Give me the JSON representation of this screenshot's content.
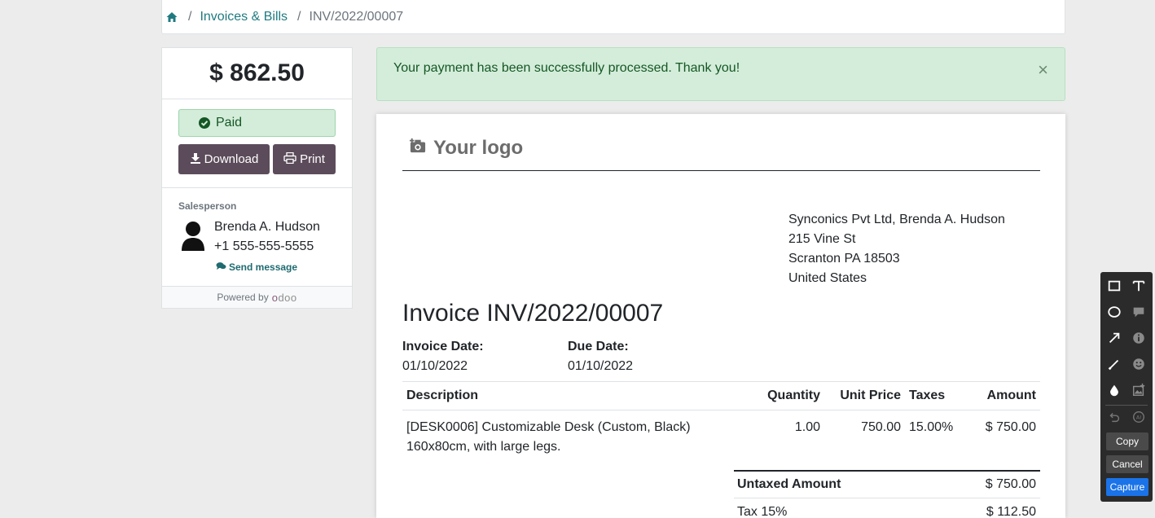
{
  "breadcrumb": {
    "home_icon": "home-icon",
    "link": "Invoices & Bills",
    "current": "INV/2022/00007"
  },
  "summary": {
    "amount": "$ 862.50",
    "status": "Paid",
    "download_label": "Download",
    "print_label": "Print",
    "salesperson_label": "Salesperson",
    "salesperson_name": "Brenda A. Hudson",
    "salesperson_phone": "+1 555-555-5555",
    "send_message_label": "Send message",
    "powered_by": "Powered by",
    "brand": "odoo"
  },
  "alert": {
    "message": "Your payment has been successfully processed. Thank you!",
    "close": "×"
  },
  "invoice": {
    "logo_text": "Your logo",
    "address": [
      "Synconics Pvt Ltd, Brenda A. Hudson",
      "215 Vine St",
      "Scranton PA 18503",
      "United States"
    ],
    "title": "Invoice INV/2022/00007",
    "invoice_date_label": "Invoice Date:",
    "invoice_date": "01/10/2022",
    "due_date_label": "Due Date:",
    "due_date": "01/10/2022",
    "columns": {
      "description": "Description",
      "quantity": "Quantity",
      "unit_price": "Unit Price",
      "taxes": "Taxes",
      "amount": "Amount"
    },
    "lines": [
      {
        "description_1": "[DESK0006] Customizable Desk (Custom, Black)",
        "description_2": "160x80cm, with large legs.",
        "quantity": "1.00",
        "unit_price": "750.00",
        "taxes": "15.00%",
        "amount": "$ 750.00"
      }
    ],
    "totals": {
      "untaxed_label": "Untaxed Amount",
      "untaxed_value": "$ 750.00",
      "tax_label": "Tax 15%",
      "tax_value": "$ 112.50"
    }
  },
  "capture_toolbar": {
    "copy": "Copy",
    "cancel": "Cancel",
    "capture": "Capture"
  },
  "colors": {
    "button": "#5c4c5b",
    "success_bg": "#d4edda",
    "success_text": "#155724",
    "link": "#1f7a80",
    "capture_primary": "#1a73e8"
  }
}
